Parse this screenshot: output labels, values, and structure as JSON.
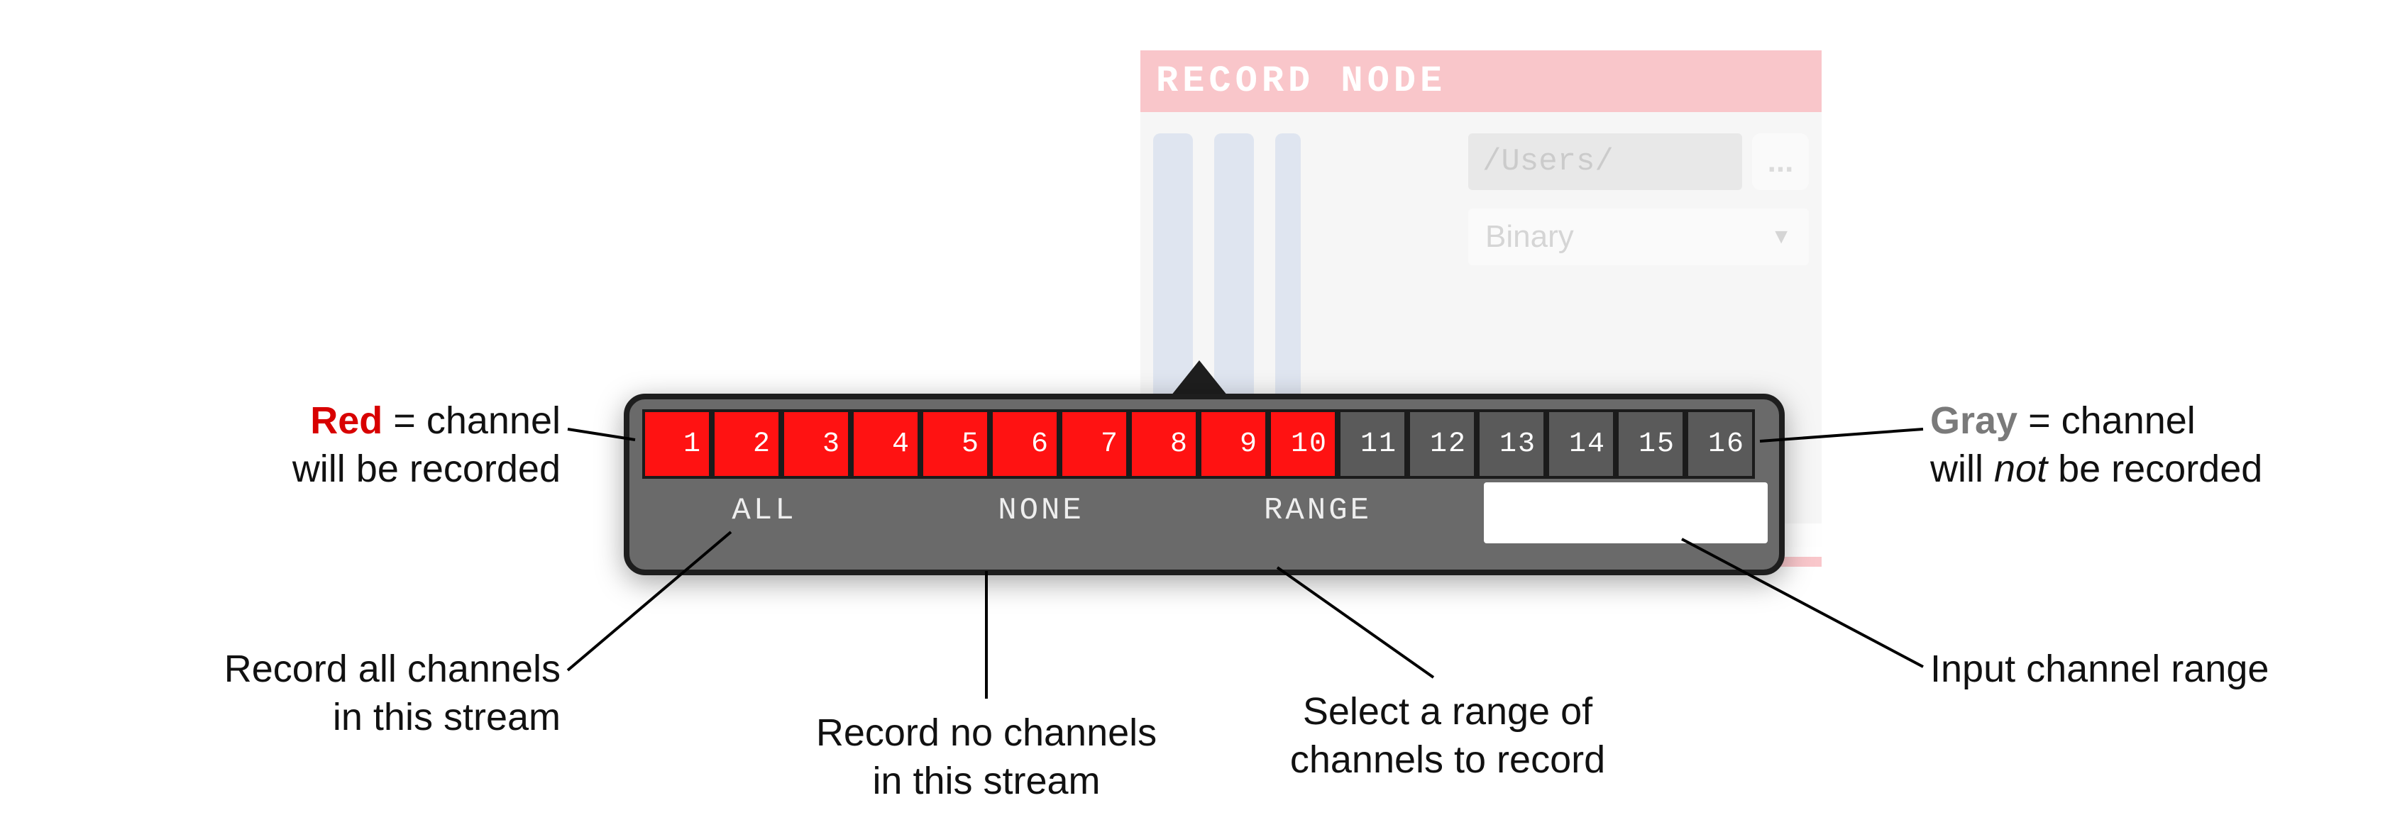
{
  "bg_panel": {
    "title": "RECORD NODE",
    "path_value": "/Users/",
    "browse_label": "...",
    "format_value": "Binary"
  },
  "popup": {
    "channels": [
      {
        "n": "1",
        "state": "red"
      },
      {
        "n": "2",
        "state": "red"
      },
      {
        "n": "3",
        "state": "red"
      },
      {
        "n": "4",
        "state": "red"
      },
      {
        "n": "5",
        "state": "red"
      },
      {
        "n": "6",
        "state": "red"
      },
      {
        "n": "7",
        "state": "red"
      },
      {
        "n": "8",
        "state": "red"
      },
      {
        "n": "9",
        "state": "red"
      },
      {
        "n": "10",
        "state": "red"
      },
      {
        "n": "11",
        "state": "gray"
      },
      {
        "n": "12",
        "state": "gray"
      },
      {
        "n": "13",
        "state": "gray"
      },
      {
        "n": "14",
        "state": "gray"
      },
      {
        "n": "15",
        "state": "gray"
      },
      {
        "n": "16",
        "state": "gray"
      }
    ],
    "btn_all": "ALL",
    "btn_none": "NONE",
    "btn_range": "RANGE",
    "range_input_value": ""
  },
  "annotations": {
    "red_word": "Red",
    "red_rest_line1": " = channel",
    "red_line2": "will be recorded",
    "gray_word": "Gray",
    "gray_rest_line1": " = channel",
    "gray_line2a": "will ",
    "gray_line2_em": "not",
    "gray_line2b": " be recorded",
    "all_line1": "Record all channels",
    "all_line2": "in this stream",
    "none_line1": "Record no channels",
    "none_line2": "in this stream",
    "range_line1": "Select a range of",
    "range_line2": "channels to record",
    "input_line": "Input channel range"
  }
}
